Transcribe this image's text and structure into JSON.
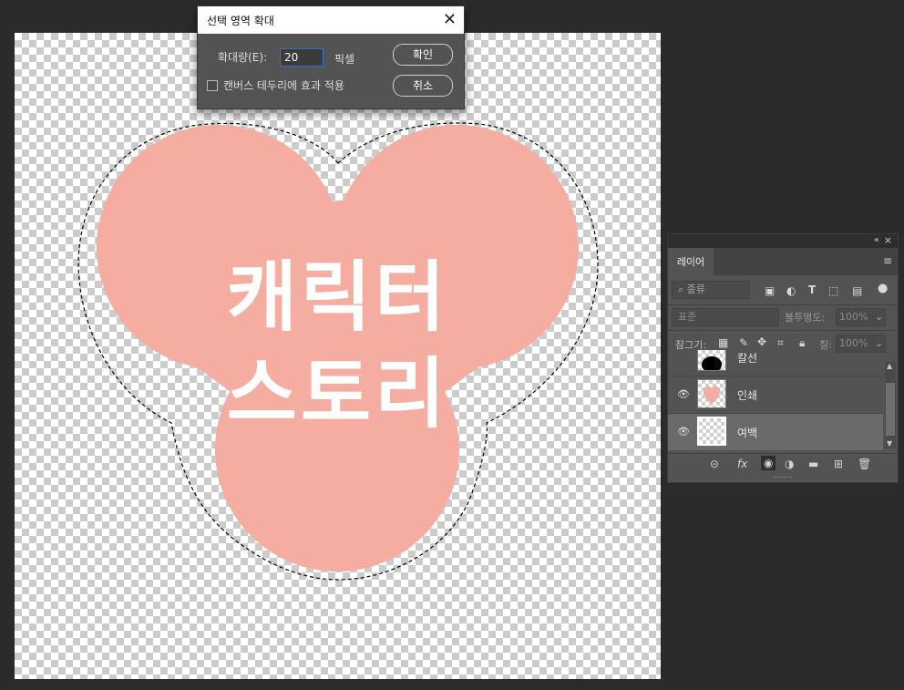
{
  "dialog": {
    "title": "선택 영역 확대",
    "expand_label": "확대량(E):",
    "expand_value": "20",
    "unit": "픽셀",
    "canvas_bounds_label": "캔버스 테두리에 효과 적용",
    "canvas_bounds_checked": false,
    "ok_label": "확인",
    "cancel_label": "취소",
    "close_icon": "close-icon"
  },
  "artwork": {
    "line1": "캐릭터",
    "line2": "스토리",
    "shape_color": "#f4ada0",
    "text_color": "#ffffff"
  },
  "layers_panel": {
    "tab_label": "레이어",
    "filter_value": "종류",
    "blend_mode": "표준",
    "opacity_label": "불투명도:",
    "opacity_value": "100%",
    "lock_label": "잠그기:",
    "fill_label": "칠:",
    "fill_value": "100%",
    "layers": [
      {
        "name": "칼선",
        "visible": false,
        "selected": false,
        "thumb": "black-shape"
      },
      {
        "name": "인쇄",
        "visible": true,
        "selected": false,
        "thumb": "pink-heart"
      },
      {
        "name": "여백",
        "visible": true,
        "selected": true,
        "thumb": "transparent"
      }
    ]
  }
}
